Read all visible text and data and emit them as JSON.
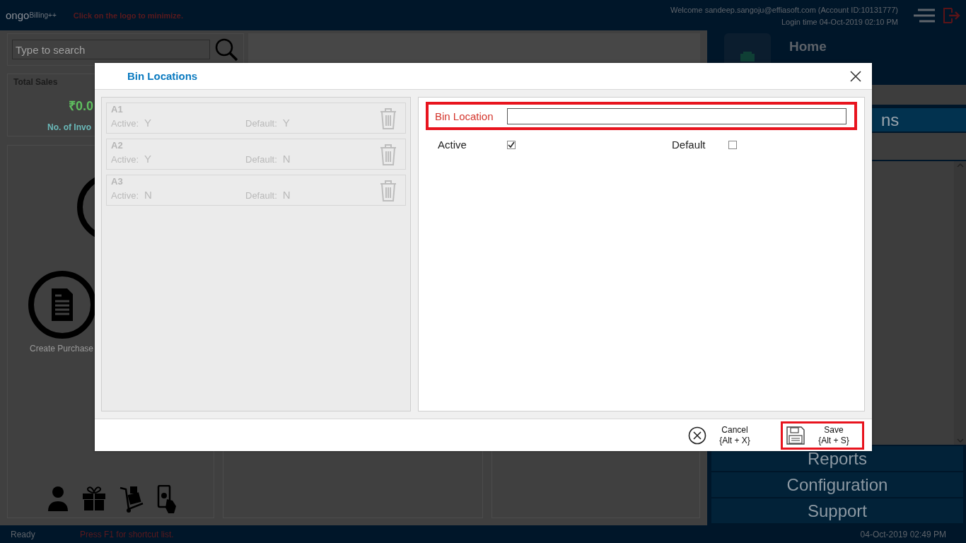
{
  "header": {
    "logo": "ongo",
    "logo_suffix": "Billing++",
    "hint": "Click on the logo to minimize.",
    "welcome": "Welcome sandeep.sangoju@effiasoft.com (Account ID:10131777)",
    "login_time": "Login time  04-Oct-2019 02:10 PM"
  },
  "search": {
    "placeholder": "Type to search"
  },
  "sales_card": {
    "title": "Total Sales",
    "amount": "₹0.0",
    "invoices": "No. of Invo"
  },
  "actions_card": {
    "items": [
      "Create Purchase"
    ]
  },
  "right_panel": {
    "title": "Home",
    "menu": [
      {
        "label": "ns",
        "selected": true
      }
    ],
    "bottom_menu": [
      "Reports",
      "Configuration",
      "Support"
    ]
  },
  "status_bar": {
    "status": "Ready",
    "hint": "Press F1 for shortcut list.",
    "datetime": "04-Oct-2019 02:49 PM"
  },
  "dialog": {
    "title": "Bin Locations",
    "bins": [
      {
        "name": "A1",
        "active_label": "Active:",
        "active": "Y",
        "default_label": "Default:",
        "default": "Y"
      },
      {
        "name": "A2",
        "active_label": "Active:",
        "active": "Y",
        "default_label": "Default:",
        "default": "N"
      },
      {
        "name": "A3",
        "active_label": "Active:",
        "active": "N",
        "default_label": "Default:",
        "default": "N"
      }
    ],
    "field": {
      "label": "Bin Location",
      "highlighted": true
    },
    "checks": [
      {
        "label": "Active",
        "checked": true
      },
      {
        "label": "Default",
        "checked": false
      }
    ],
    "buttons": [
      {
        "kind": "cancel",
        "label": "Cancel",
        "shortcut": "{Alt + X}",
        "highlighted": false
      },
      {
        "kind": "save",
        "label": "Save",
        "shortcut": "{Alt + S}",
        "highlighted": true
      }
    ]
  }
}
